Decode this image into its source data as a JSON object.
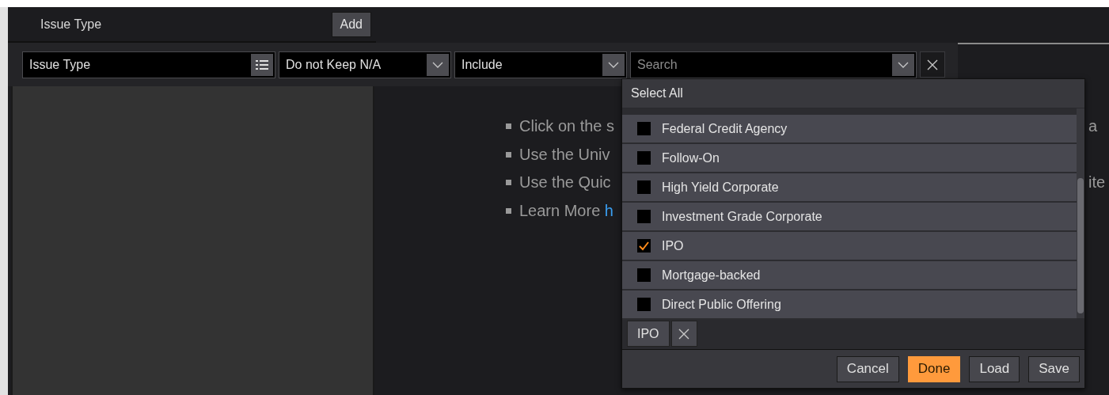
{
  "header": {
    "title": "Issue Type",
    "add_button": "Add"
  },
  "filter": {
    "field": "Issue Type",
    "na_select": "Do not Keep N/A",
    "mode_select": "Include",
    "search": {
      "placeholder": "Search"
    }
  },
  "help": {
    "bullets": [
      {
        "text": "Click on the s",
        "trailing": "a"
      },
      {
        "text": "Use the Univ"
      },
      {
        "text": "Use the Quic",
        "trailing": "ite"
      },
      {
        "text": "Learn More ",
        "link": "h"
      }
    ]
  },
  "dropdown": {
    "select_all": "Select All",
    "options": [
      {
        "label": "Federal Credit Agency",
        "checked": false
      },
      {
        "label": "Follow-On",
        "checked": false
      },
      {
        "label": "High Yield Corporate",
        "checked": false
      },
      {
        "label": "Investment Grade Corporate",
        "checked": false
      },
      {
        "label": "IPO",
        "checked": true
      },
      {
        "label": "Mortgage-backed",
        "checked": false
      },
      {
        "label": "Direct Public Offering",
        "checked": false
      }
    ],
    "chips": [
      {
        "label": "IPO"
      }
    ],
    "buttons": [
      {
        "label": "Cancel",
        "primary": false
      },
      {
        "label": "Done",
        "primary": true
      },
      {
        "label": "Load",
        "primary": false
      },
      {
        "label": "Save",
        "primary": false
      }
    ]
  }
}
